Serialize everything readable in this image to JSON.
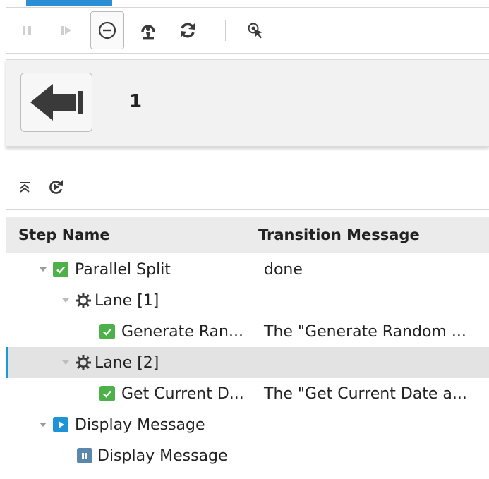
{
  "toolbar": {
    "buttons": [
      {
        "name": "pause",
        "icon": "pause-icon"
      },
      {
        "name": "step-forward",
        "icon": "step-forward-icon"
      },
      {
        "name": "cancel",
        "icon": "cancel-icon"
      },
      {
        "name": "reassign",
        "icon": "reassign-icon"
      },
      {
        "name": "refresh",
        "icon": "refresh-icon"
      },
      {
        "name": "select-target",
        "icon": "cursor-target-icon"
      }
    ]
  },
  "panel": {
    "back_icon": "back-arrow-icon",
    "counter": "1"
  },
  "tree_toolbar": {
    "collapse_icon": "collapse-all-icon",
    "replay_icon": "replay-icon"
  },
  "grid": {
    "columns": {
      "step_name": "Step Name",
      "transition_message": "Transition Message"
    },
    "rows": [
      {
        "name": "Parallel Split",
        "message": "done",
        "icon": "check-icon",
        "expanded": true,
        "selected": false
      },
      {
        "name": "Lane [1]",
        "message": "",
        "icon": "gear-icon",
        "expanded": true,
        "selected": false
      },
      {
        "name": "Generate Ran...",
        "message": "The \"Generate Random ...",
        "icon": "check-icon",
        "expanded": false,
        "selected": false
      },
      {
        "name": "Lane [2]",
        "message": "",
        "icon": "gear-icon",
        "expanded": true,
        "selected": true
      },
      {
        "name": "Get Current D...",
        "message": "The \"Get Current Date a...",
        "icon": "check-icon",
        "expanded": false,
        "selected": false
      },
      {
        "name": "Display Message",
        "message": "",
        "icon": "play-icon",
        "expanded": true,
        "selected": false
      },
      {
        "name": "Display Message",
        "message": "",
        "icon": "pause-icon",
        "expanded": false,
        "selected": false
      }
    ]
  },
  "colors": {
    "accent": "#2b8fd6",
    "success": "#4db14a",
    "running": "#1e93d6",
    "paused": "#5b87ad",
    "selection": "#e3e3e3"
  }
}
